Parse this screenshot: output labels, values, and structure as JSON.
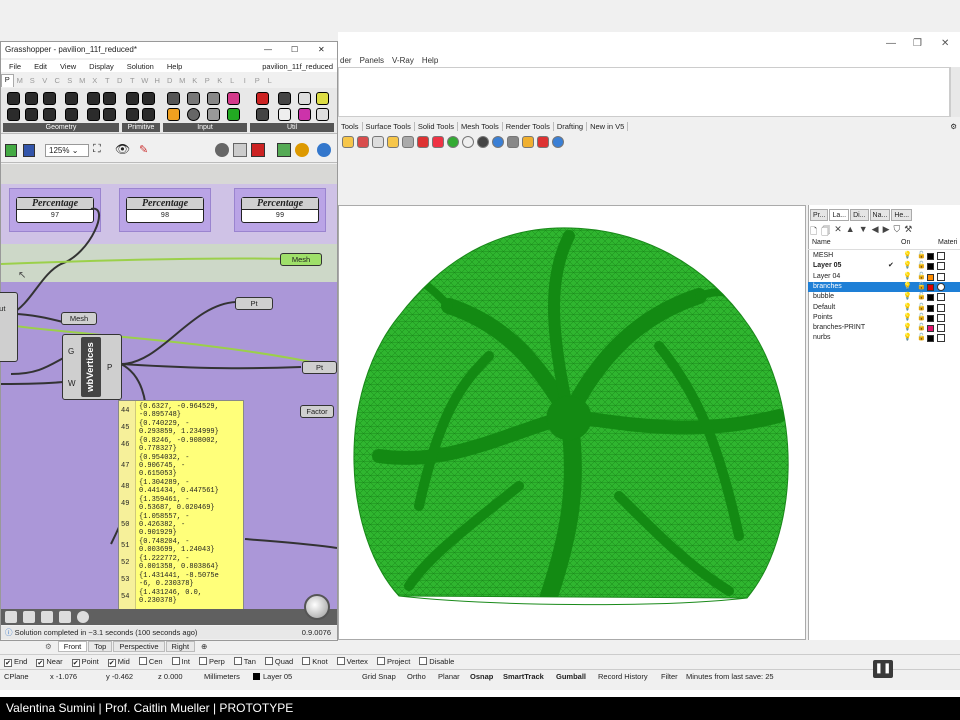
{
  "rhino": {
    "menus": [
      "der",
      "Panels",
      "V-Ray",
      "Help"
    ],
    "toolbar_tabs": [
      "Tools",
      "Surface Tools",
      "Solid Tools",
      "Mesh Tools",
      "Render Tools",
      "Drafting",
      "New in V5"
    ],
    "viewport_tabs": [
      "Front",
      "Top",
      "Perspective",
      "Right"
    ],
    "osnaps": [
      {
        "label": "End",
        "checked": true
      },
      {
        "label": "Near",
        "checked": true
      },
      {
        "label": "Point",
        "checked": true
      },
      {
        "label": "Mid",
        "checked": true
      },
      {
        "label": "Cen",
        "checked": false
      },
      {
        "label": "Int",
        "checked": false
      },
      {
        "label": "Perp",
        "checked": false
      },
      {
        "label": "Tan",
        "checked": false
      },
      {
        "label": "Quad",
        "checked": false
      },
      {
        "label": "Knot",
        "checked": false
      },
      {
        "label": "Vertex",
        "checked": false
      },
      {
        "label": "Project",
        "checked": false
      },
      {
        "label": "Disable",
        "checked": false
      }
    ],
    "status": {
      "cplane": "CPlane",
      "x": "x -1.076",
      "y": "y -0.462",
      "z": "z 0.000",
      "units": "Millimeters",
      "layer": "Layer 05",
      "grid_snap": "Grid Snap",
      "ortho": "Ortho",
      "planar": "Planar",
      "osnap": "Osnap",
      "smarttrack": "SmartTrack",
      "gumball": "Gumball",
      "record_history": "Record History",
      "filter": "Filter",
      "autosave": "Minutes from last save: 25"
    }
  },
  "layers_panel": {
    "tabs": [
      "Pr...",
      "La...",
      "Di...",
      "Na...",
      "He..."
    ],
    "columns": {
      "name": "Name",
      "on": "On",
      "material": "Materi"
    },
    "rows": [
      {
        "name": "MESH",
        "color": "#000000",
        "current": false,
        "selected": false
      },
      {
        "name": "Layer 05",
        "color": "#000000",
        "current": true,
        "selected": false
      },
      {
        "name": "Layer 04",
        "color": "#ff8c00",
        "current": false,
        "selected": false
      },
      {
        "name": "branches",
        "color": "#e00000",
        "current": false,
        "selected": true
      },
      {
        "name": "bubble",
        "color": "#000000",
        "current": false,
        "selected": false
      },
      {
        "name": "Default",
        "color": "#000000",
        "current": false,
        "selected": false
      },
      {
        "name": "Points",
        "color": "#000000",
        "current": false,
        "selected": false
      },
      {
        "name": "branches-PRINT",
        "color": "#e0106a",
        "current": false,
        "selected": false
      },
      {
        "name": "nurbs",
        "color": "#000000",
        "current": false,
        "selected": false
      }
    ]
  },
  "grasshopper": {
    "title": "Grasshopper - pavilion_11f_reduced*",
    "file": "pavilion_11f_reduced",
    "menus": [
      "File",
      "Edit",
      "View",
      "Display",
      "Solution",
      "Help"
    ],
    "tabs": [
      "P",
      "M",
      "S",
      "V",
      "C",
      "S",
      "M",
      "X",
      "T",
      "D",
      "T",
      "W",
      "H",
      "D",
      "M",
      "K",
      "P",
      "K",
      "L",
      "I",
      "P",
      "L"
    ],
    "groups": [
      "Geometry",
      "Primitive",
      "Input",
      "Util"
    ],
    "zoom": "125%",
    "percentages": [
      {
        "title": "Percentage",
        "value": "97"
      },
      {
        "title": "Percentage",
        "value": "98"
      },
      {
        "title": "Percentage",
        "value": "99"
      }
    ],
    "components": {
      "mesh_top": "Mesh",
      "mesh_mid": "Mesh",
      "pt_top": "Pt",
      "pt_right": "Pt",
      "factor": "Factor",
      "wbvertices": "wbVertices",
      "in_g": "G",
      "in_w": "W",
      "out_p": "P",
      "cut": "out"
    },
    "panel_rows": [
      {
        "i": "44",
        "text": "{0.6327, -0.964529,\n-0.895748}"
      },
      {
        "i": "45",
        "text": "{0.740229, -\n0.293859, 1.234999}"
      },
      {
        "i": "46",
        "text": "{0.8246, -0.908002,\n0.778327}"
      },
      {
        "i": "47",
        "text": "{0.954032, -\n0.906745, -\n0.615053}"
      },
      {
        "i": "48",
        "text": "{1.304289, -\n0.441434, 0.447561}"
      },
      {
        "i": "49",
        "text": "{1.359461, -\n0.53687, 0.020469}"
      },
      {
        "i": "50",
        "text": "{1.058557, -\n0.426382, -\n0.901929}"
      },
      {
        "i": "51",
        "text": "{0.748204, -\n0.003699, 1.24043}"
      },
      {
        "i": "52",
        "text": "{1.222772, -\n0.001358, 0.803864}"
      },
      {
        "i": "53",
        "text": "{1.431441, -8.5075e\n-6, 0.230378}"
      },
      {
        "i": "54",
        "text": "{1.431246, 0.0,\n0.230378}"
      }
    ],
    "status": "Solution completed in ~3.1 seconds (100 seconds ago)",
    "version": "0.9.0076"
  },
  "footer": "Valentina Sumini | Prof. Caitlin Mueller | PROTOTYPE",
  "colors": {
    "mesh": "#1f9e1f",
    "canvas_purple": "#ab97d8",
    "selected_row": "#1e7fd6"
  }
}
